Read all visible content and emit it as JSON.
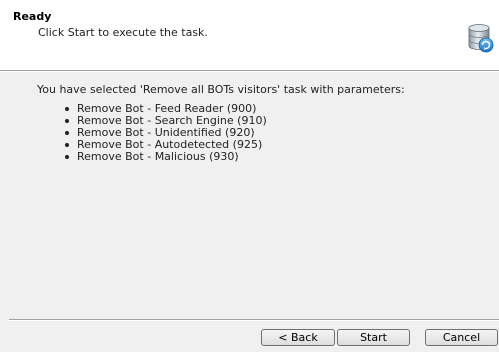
{
  "header": {
    "title": "Ready",
    "subtitle": "Click Start to execute the task.",
    "icon": "database-task-icon"
  },
  "content": {
    "intro": "You have selected 'Remove all BOTs visitors' task with parameters:",
    "parameters": [
      "Remove Bot - Feed Reader (900)",
      "Remove Bot - Search Engine (910)",
      "Remove Bot - Unidentified (920)",
      "Remove Bot - Autodetected (925)",
      "Remove Bot - Malicious (930)"
    ]
  },
  "buttons": {
    "back": "< Back",
    "start": "Start",
    "cancel": "Cancel"
  },
  "colors": {
    "header_bg": "#ffffff",
    "body_bg": "#f0f0f0",
    "separator": "#a0a0a0"
  }
}
